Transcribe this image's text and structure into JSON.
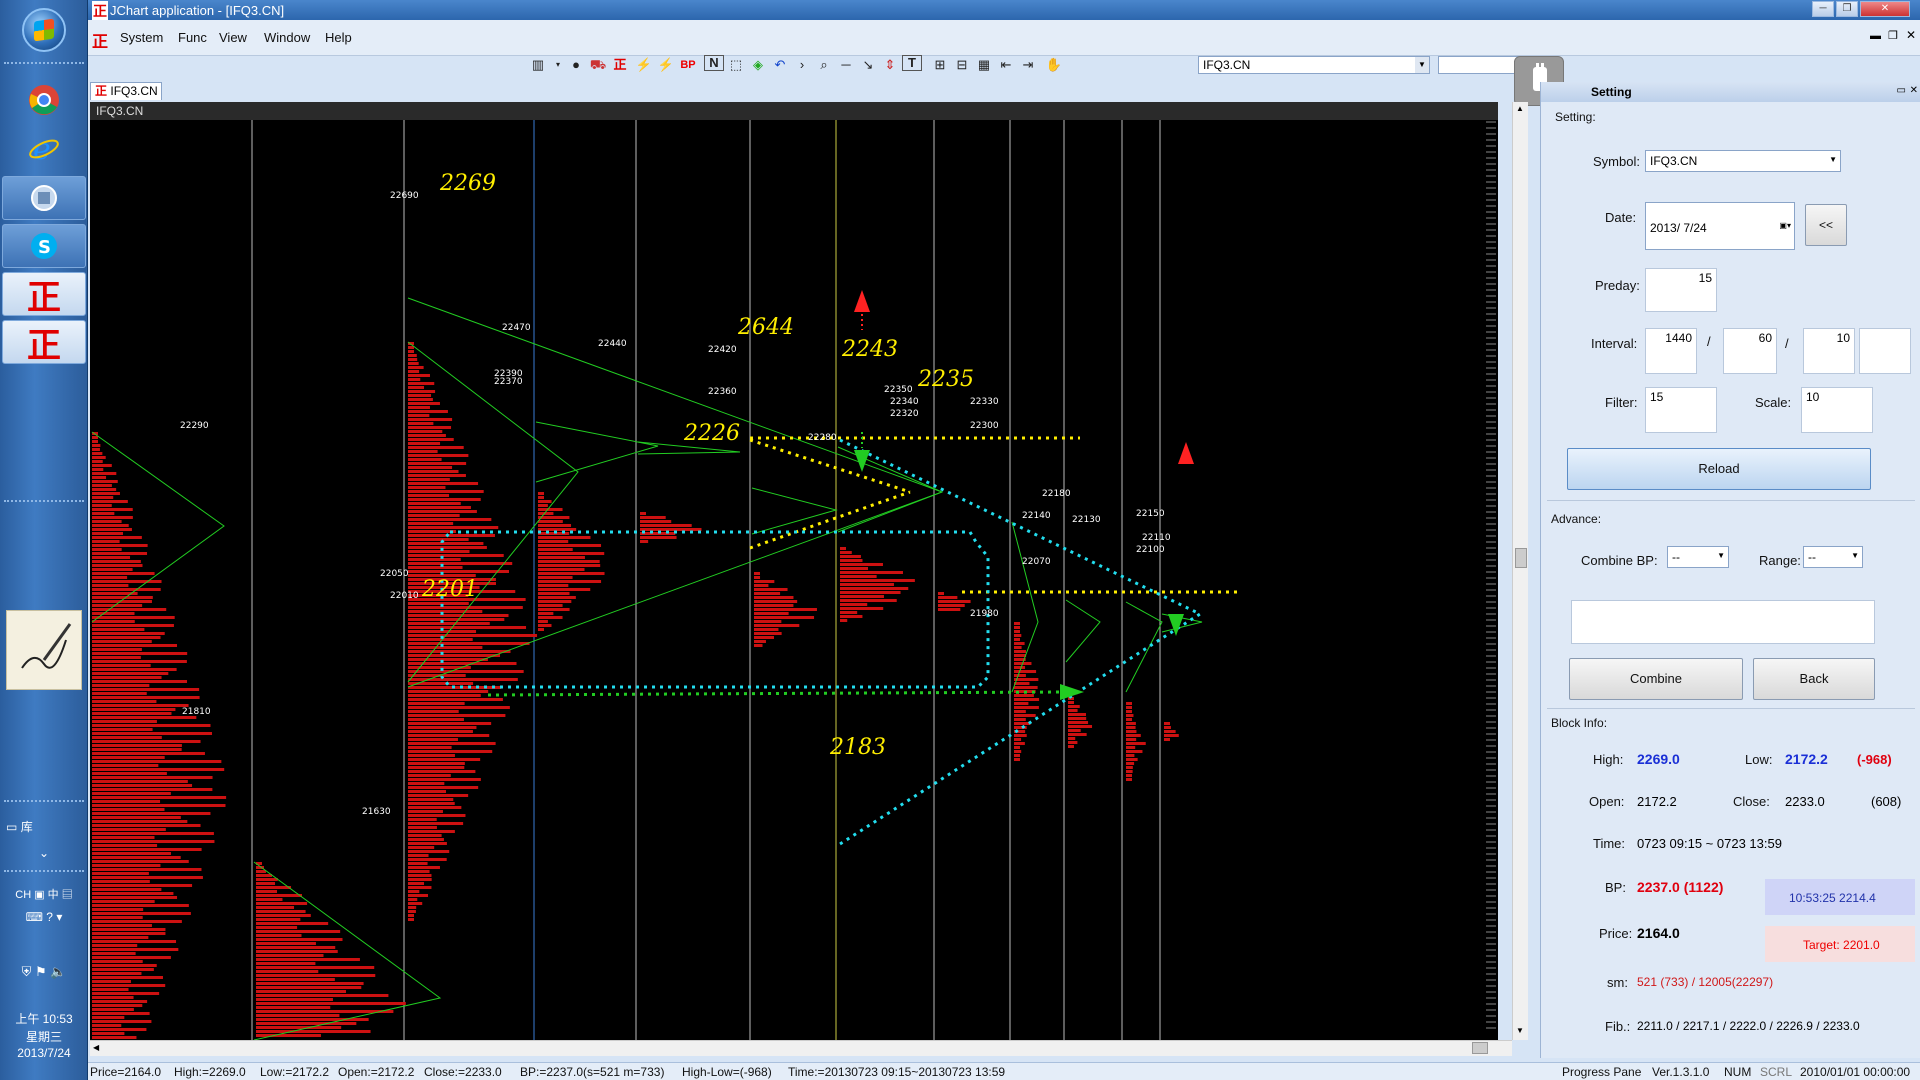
{
  "window": {
    "title": "JChart application - [IFQ3.CN]"
  },
  "menu": {
    "items": [
      "System",
      "Func",
      "View",
      "Window",
      "Help"
    ]
  },
  "toolbar": {
    "bp_label": "BP",
    "n_label": "N",
    "t_label": "T",
    "symbol": "IFQ3.CN"
  },
  "doc_tab": {
    "label": "IFQ3.CN"
  },
  "chart": {
    "header": "IFQ3.CN",
    "annotations": [
      "2269",
      "2644",
      "2243",
      "2235",
      "2226",
      "2201",
      "2183"
    ],
    "price_labels": [
      "22690",
      "22470",
      "22440",
      "22420",
      "22390",
      "22370",
      "22360",
      "22350",
      "22340",
      "22330",
      "22320",
      "22300",
      "22290",
      "22280",
      "22180",
      "22150",
      "22140",
      "22130",
      "22110",
      "22100",
      "22070",
      "22050",
      "22010",
      "21980",
      "21810",
      "21630"
    ]
  },
  "panel": {
    "header": "Setting",
    "section_setting": "Setting:",
    "symbol_label": "Symbol:",
    "symbol_value": "IFQ3.CN",
    "date_label": "Date:",
    "date_value": "2013/  7/24",
    "date_btn": "<<",
    "preday_label": "Preday:",
    "preday_value": "15",
    "interval_label": "Interval:",
    "interval_1": "1440",
    "interval_2": "60",
    "interval_3": "10",
    "interval_sep": "/",
    "filter_label": "Filter:",
    "filter_value": "15",
    "scale_label": "Scale:",
    "scale_value": "10",
    "reload_btn": "Reload",
    "section_advance": "Advance:",
    "combine_bp_label": "Combine BP:",
    "combine_bp_value": "--",
    "range_label": "Range:",
    "range_value": "--",
    "combine_btn": "Combine",
    "back_btn": "Back",
    "section_block": "Block Info:",
    "high_label": "High:",
    "high_value": "2269.0",
    "low_label": "Low:",
    "low_value": "2172.2",
    "low_diff": "(-968)",
    "open_label": "Open:",
    "open_value": "2172.2",
    "close_label": "Close:",
    "close_value": "2233.0",
    "close_diff": "(608)",
    "time_label": "Time:",
    "time_value": "0723 09:15 ~ 0723 13:59",
    "bp_label": "BP:",
    "bp_value": "2237.0 (1122)",
    "bp_time": "10:53:25  2214.4",
    "price_label": "Price:",
    "price_value": "2164.0",
    "target": "Target: 2201.0",
    "sm_label": "sm:",
    "sm_value": "521 (733) / 12005(22297)",
    "fib_label": "Fib.:",
    "fib_value": "2211.0 / 2217.1 / 2222.0 / 2226.9 / 2233.0"
  },
  "status": {
    "price": "Price=2164.0",
    "high": "High:=2269.0",
    "low": "Low:=2172.2",
    "open": "Open:=2172.2",
    "close": "Close:=2233.0",
    "bp": "BP:=2237.0(s=521 m=733)",
    "hl": "High-Low=(-968)",
    "time": "Time:=20130723 09:15~20130723 13:59",
    "pane": "Progress Pane",
    "ver": "Ver.1.3.1.0",
    "num": "NUM",
    "scrl": "SCRL",
    "datetime": "2010/01/01 00:00:00"
  },
  "taskbar": {
    "lib_label": "库",
    "ime": "CH",
    "ime2": "中",
    "time": "上午 10:53",
    "weekday": "星期三",
    "date": "2013/7/24"
  },
  "colors": {
    "profile_red": "#cc1111",
    "trend_green": "#22cc22",
    "dot_yellow": "#ffee00",
    "dot_cyan": "#22ddee",
    "annot_yellow": "#ffee00"
  }
}
